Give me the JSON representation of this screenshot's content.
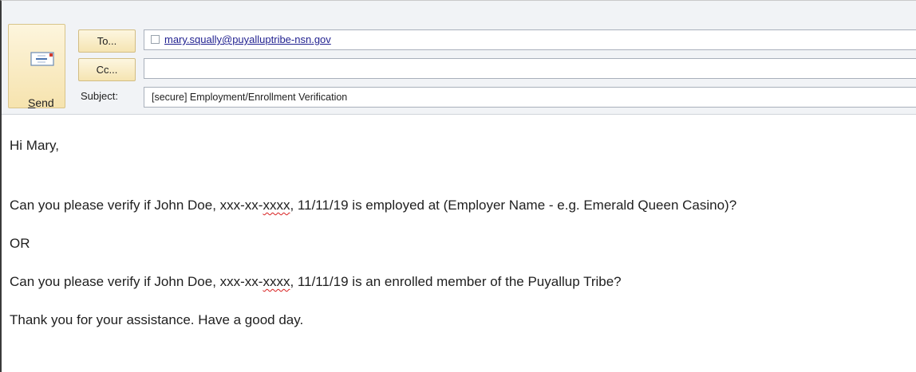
{
  "compose": {
    "send_label": "end",
    "send_underline": "S",
    "to_label": "To...",
    "cc_label": "Cc...",
    "subject_label": "Subject:",
    "to_recipient": "mary.squally@puyalluptribe-nsn.gov",
    "cc_value": "",
    "subject_value": "[secure] Employment/Enrollment Verification"
  },
  "message": {
    "greeting": "Hi Mary,",
    "line1_before": "Can you please verify if John Doe, xxx-xx-",
    "line1_squiggle": "xxxx",
    "line1_after": ", 11/11/19 is employed at (Employer Name - e.g. Emerald Queen Casino)?",
    "or": "OR",
    "line2_before": "Can you please verify if John Doe, xxx-xx-",
    "line2_squiggle": "xxxx",
    "line2_after": ", 11/11/19 is an enrolled member of the Puyallup Tribe?",
    "closing": "Thank you for your assistance.  Have a good day."
  }
}
